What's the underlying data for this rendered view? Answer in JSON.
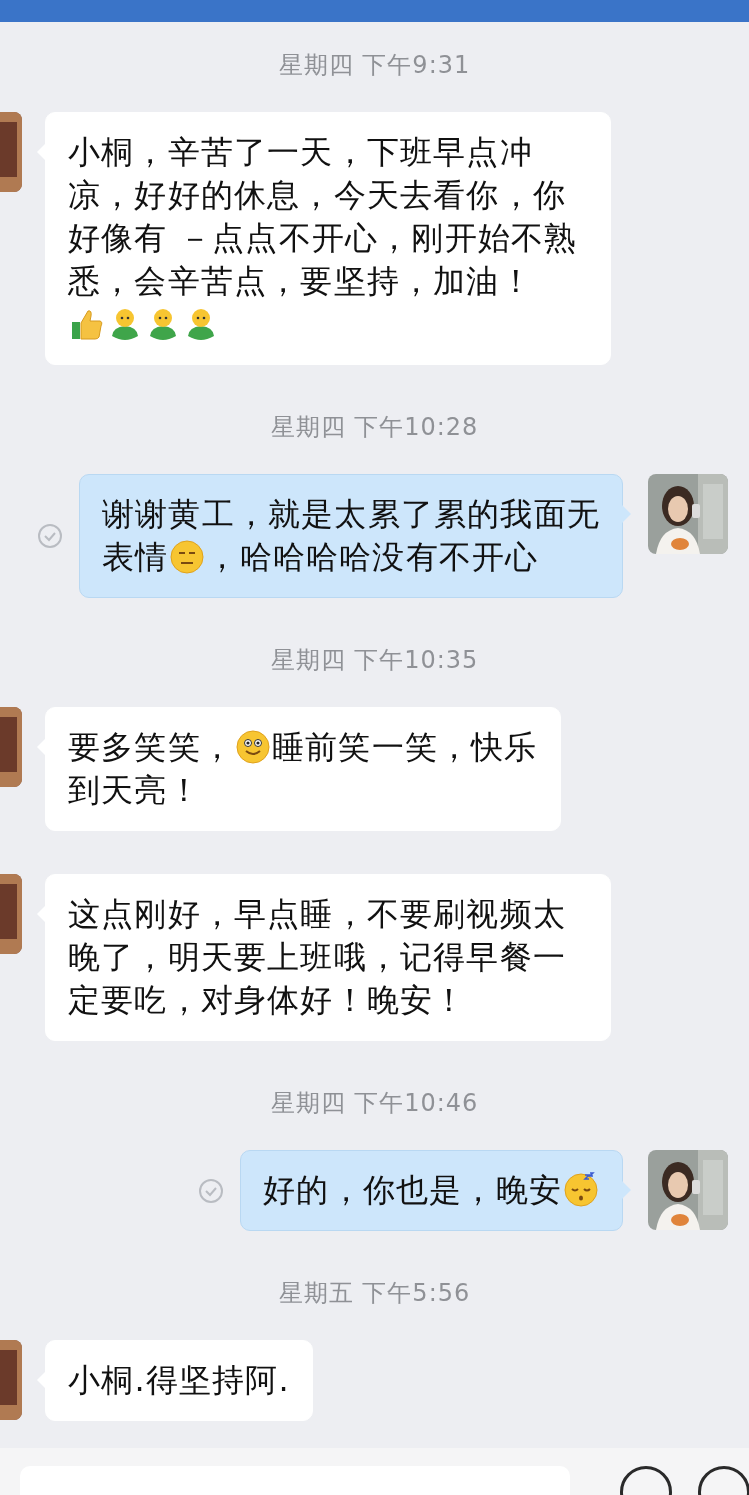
{
  "messages": [
    {
      "kind": "timestamp",
      "text": "星期四 下午9:31"
    },
    {
      "kind": "received",
      "parts": [
        {
          "kind": "text",
          "text": "小桐，辛苦了一天，下班早点冲凉，好好的休息，今天去看你，你好像有 －点点不开心，刚开始不熟悉，会辛苦点，要坚持，加油！"
        },
        {
          "kind": "break"
        },
        {
          "kind": "thumbs-up"
        },
        {
          "kind": "figure"
        },
        {
          "kind": "figure"
        },
        {
          "kind": "figure"
        }
      ]
    },
    {
      "kind": "timestamp",
      "text": "星期四 下午10:28"
    },
    {
      "kind": "sent",
      "parts": [
        {
          "kind": "text",
          "text": "谢谢黄工，就是太累了累的我面无"
        },
        {
          "kind": "break"
        },
        {
          "kind": "text",
          "text": "表情"
        },
        {
          "kind": "expressionless"
        },
        {
          "kind": "text",
          "text": "，哈哈哈哈没有不开心"
        }
      ]
    },
    {
      "kind": "timestamp",
      "text": "星期四 下午10:35"
    },
    {
      "kind": "received",
      "parts": [
        {
          "kind": "text",
          "text": "要多笑笑，"
        },
        {
          "kind": "smile"
        },
        {
          "kind": "text",
          "text": "睡前笑一笑，快乐"
        },
        {
          "kind": "break"
        },
        {
          "kind": "text",
          "text": "到天亮！"
        }
      ]
    },
    {
      "kind": "received",
      "parts": [
        {
          "kind": "text",
          "text": "这点刚好，早点睡，不要刷视频太晚了，明天要上班哦，记得早餐一定要吃，对身体好！晚安！"
        }
      ]
    },
    {
      "kind": "timestamp",
      "text": "星期四 下午10:46"
    },
    {
      "kind": "sent",
      "parts": [
        {
          "kind": "text",
          "text": "好的，你也是，晚安"
        },
        {
          "kind": "sleepy"
        }
      ]
    },
    {
      "kind": "timestamp",
      "text": "星期五 下午5:56"
    },
    {
      "kind": "received",
      "parts": [
        {
          "kind": "text",
          "text": "小桐.得坚持阿."
        }
      ]
    }
  ]
}
